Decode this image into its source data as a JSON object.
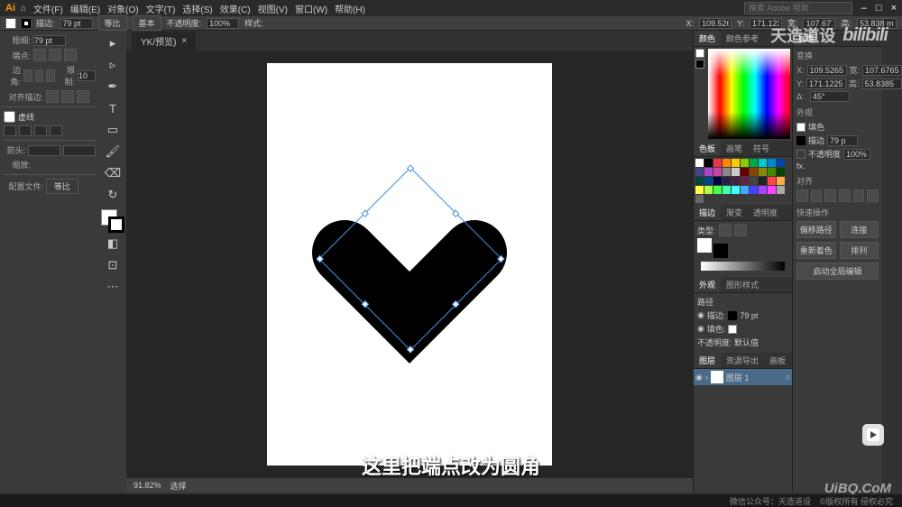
{
  "app": {
    "logo": "Ai"
  },
  "menu": [
    "文件(F)",
    "编辑(E)",
    "对象(O)",
    "文字(T)",
    "选择(S)",
    "效果(C)",
    "视图(V)",
    "窗口(W)",
    "帮助(H)"
  ],
  "search_placeholder": "搜索 Adobe 帮助",
  "control_bar": {
    "stroke_label": "描边:",
    "stroke_width": "79 pt",
    "uniform": "等比",
    "basic": "基本",
    "opacity_label": "不透明度:",
    "opacity": "100%",
    "style_label": "样式:",
    "x_label": "X:",
    "x": "109.526",
    "y_label": "Y:",
    "y": "171.123",
    "w_label": "宽:",
    "w": "107.677",
    "h_label": "高:",
    "h": "53.838 m"
  },
  "left_panel": {
    "stroke_label": "粗细:",
    "stroke": "79 pt",
    "cap_label": "端点:",
    "corner_label": "边角:",
    "limit_label": "限制:",
    "limit": "10",
    "align_label": "对齐描边:",
    "dash_label": "虚线",
    "arrow_label": "箭头:",
    "scale_label": "缩放:",
    "config_label": "配置文件:",
    "uniform": "等比"
  },
  "doc_tab": {
    "name": "YK/预览)",
    "close": "×"
  },
  "status": {
    "zoom": "91.82%",
    "mode": "选择"
  },
  "right": {
    "panel_color": {
      "tabs": [
        "颜色",
        "颜色参考"
      ]
    },
    "panel_swatch": {
      "tabs": [
        "色板",
        "画笔",
        "符号"
      ]
    },
    "panel_stroke": {
      "tabs": [
        "描边",
        "渐变",
        "透明度"
      ],
      "type_label": "类型:"
    },
    "panel_appear": {
      "tabs": [
        "外观",
        "图形样式"
      ],
      "path": "路径",
      "stroke_row": "描边:",
      "stroke_val": "79 pt",
      "fill_row": "填色:",
      "opacity_row": "不透明度: 默认值"
    },
    "panel_layers": {
      "tabs": [
        "图层",
        "资源导出",
        "画板"
      ],
      "layer_name": "图层 1"
    },
    "panel_props": {
      "header": "属性",
      "transform": "变换",
      "x_lbl": "X:",
      "x": "109.5265",
      "w_lbl": "宽:",
      "w": "107.6765",
      "y_lbl": "Y:",
      "y": "171.1225",
      "h_lbl": "高:",
      "h": "53.8385",
      "angle_lbl": "Δ:",
      "angle": "45°",
      "appearance": "外观",
      "fill_lbl": "填色",
      "stroke_lbl": "描边",
      "stroke_val": "79 p",
      "opacity_lbl": "不透明度",
      "opacity": "100%",
      "fx": "fx.",
      "align": "对齐",
      "quick_actions": "快速操作",
      "qa": [
        "偏移路径",
        "连接",
        "重新着色",
        "排列",
        "启动全局编辑"
      ]
    }
  },
  "watermark_text": "天造道设",
  "bilibili": "bilibili",
  "caption": "这里把端点改为圆角",
  "uibq": "UiBQ.CoM",
  "footer": {
    "wechat": "微信公众号：天造道设",
    "copyright": "©版权所有 侵权必究"
  },
  "swatch_colors": [
    "#fff",
    "#000",
    "#e34",
    "#f80",
    "#fc0",
    "#8c0",
    "#0a4",
    "#0cc",
    "#08c",
    "#04a",
    "#448",
    "#a4c",
    "#c4a",
    "#888",
    "#ccc",
    "#600",
    "#840",
    "#880",
    "#480",
    "#040",
    "#044",
    "#048",
    "#004",
    "#224",
    "#424",
    "#624",
    "#444",
    "#222",
    "#f44",
    "#fa4",
    "#ff4",
    "#af4",
    "#4f4",
    "#4fa",
    "#4ff",
    "#4af",
    "#44f",
    "#a4f",
    "#f4f",
    "#aaa",
    "#666"
  ]
}
